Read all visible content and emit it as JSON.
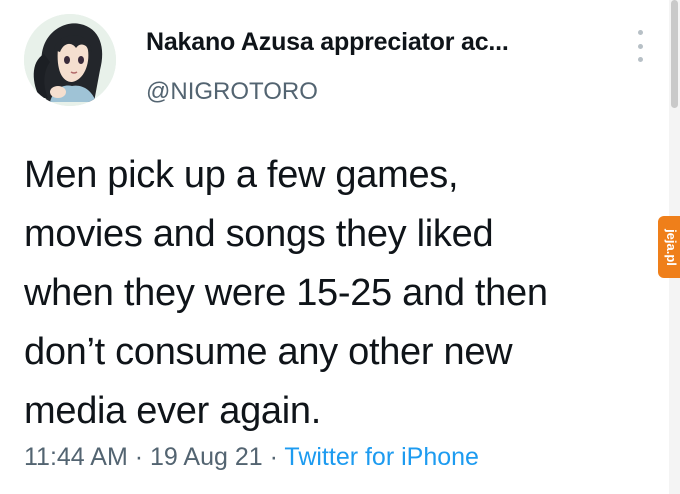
{
  "tweet": {
    "display_name": "Nakano Azusa appreciator ac...",
    "handle": "@NIGROTORO",
    "text": "Men pick up a few games,\nmovies and songs they liked\nwhen they were 15-25 and then\ndon’t consume any other new\nmedia ever again.",
    "time": "11:44 AM",
    "separator": "·",
    "date": "19 Aug 21",
    "source": "Twitter for iPhone"
  },
  "icons": {
    "avatar": "anime-girl-avatar",
    "more": "more-vertical-icon"
  },
  "watermark": {
    "text": "jeja.pl"
  },
  "colors": {
    "text": "#0f1419",
    "secondary": "#536471",
    "link": "#1d9bf0",
    "watermark": "#ef7f1a"
  }
}
